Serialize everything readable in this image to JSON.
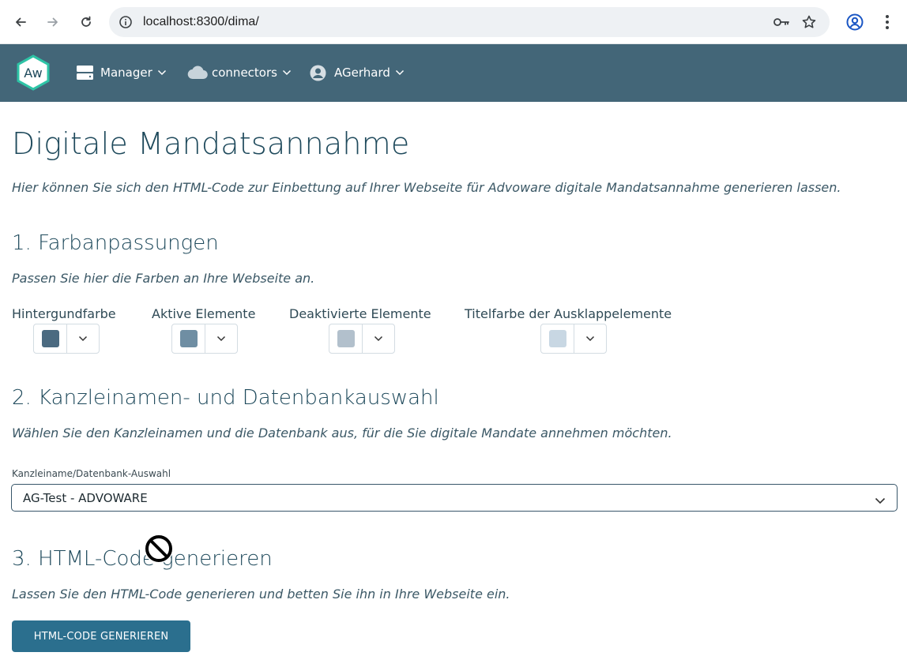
{
  "browser": {
    "url": "localhost:8300/dima/"
  },
  "navbar": {
    "logo_text": "Aw",
    "items": [
      {
        "label": "Manager",
        "icon": "server-icon"
      },
      {
        "label": "connectors",
        "icon": "cloud-icon"
      },
      {
        "label": "AGerhard",
        "icon": "user-avatar-icon"
      }
    ]
  },
  "page": {
    "title": "Digitale Mandatsannahme",
    "lead": "Hier können Sie sich den HTML-Code zur Einbettung auf Ihrer Webseite für Advoware digitale Mandatsannahme generieren lassen."
  },
  "section1": {
    "heading": "1. Farbanpassungen",
    "description": "Passen Sie hier die Farben an Ihre Webseite an.",
    "pickers": [
      {
        "label": "Hintergundfarbe",
        "color": "#4b6a80"
      },
      {
        "label": "Aktive Elemente",
        "color": "#6f8ea3"
      },
      {
        "label": "Deaktivierte Elemente",
        "color": "#b2c0cc"
      },
      {
        "label": "Titelfarbe der Ausklappelemente",
        "color": "#c8d7e3"
      }
    ]
  },
  "section2": {
    "heading": "2. Kanzleinamen- und Datenbankauswahl",
    "description": "Wählen Sie den Kanzleinamen und die Datenbank aus, für die Sie digitale Mandate annehmen möchten.",
    "field_label": "Kanzleiname/Datenbank-Auswahl",
    "selected_value": "AG-Test - ADVOWARE"
  },
  "section3": {
    "heading": "3. HTML-Code generieren",
    "description": "Lassen Sie den HTML-Code generieren und betten Sie ihn in Ihre Webseite ein.",
    "button_label": "HTML-CODE GENERIEREN"
  },
  "colors": {
    "navbar": "#436678",
    "accent": "#2b6f8e",
    "heading": "#1f4a5c"
  }
}
